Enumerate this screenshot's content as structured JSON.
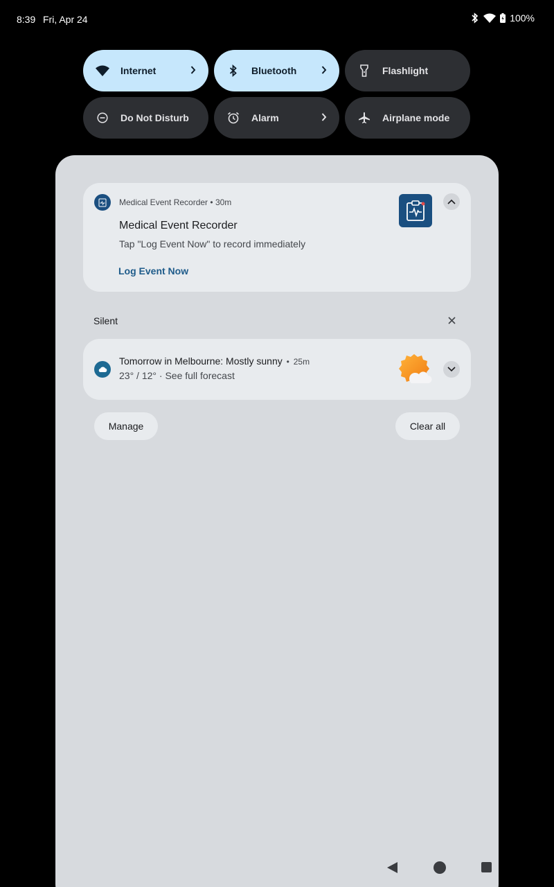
{
  "status_bar": {
    "time": "8:39",
    "date": "Fri, Apr 24",
    "battery": "100%",
    "icons": [
      "bluetooth-icon",
      "wifi-icon",
      "battery-icon"
    ]
  },
  "quick_settings": {
    "tiles": [
      {
        "label": "Internet",
        "icon": "wifi-icon",
        "active": true,
        "has_chevron": true
      },
      {
        "label": "Bluetooth",
        "icon": "bluetooth-icon",
        "active": true,
        "has_chevron": true
      },
      {
        "label": "Flashlight",
        "icon": "flashlight-icon",
        "active": false,
        "has_chevron": false
      },
      {
        "label": "Do Not Disturb",
        "icon": "do-not-disturb-icon",
        "active": false,
        "has_chevron": false
      },
      {
        "label": "Alarm",
        "icon": "alarm-icon",
        "active": false,
        "has_chevron": true
      },
      {
        "label": "Airplane mode",
        "icon": "airplane-icon",
        "active": false,
        "has_chevron": false
      }
    ]
  },
  "notifications": {
    "medical": {
      "app_name": "Medical Event Recorder",
      "separator": "•",
      "time": "30m",
      "title": "Medical Event Recorder",
      "text": "Tap \"Log Event Now\" to record immediately",
      "action": "Log Event Now"
    },
    "silent_section": {
      "label": "Silent"
    },
    "weather": {
      "title": "Tomorrow in Melbourne: Mostly sunny",
      "separator": "•",
      "time": "25m",
      "subtitle": "23° / 12° · See full forecast"
    }
  },
  "footer": {
    "manage": "Manage",
    "clear_all": "Clear all"
  },
  "colors": {
    "active_tile": "#c6e7fc",
    "inactive_tile": "#2d2f33",
    "shade": "#d7dade",
    "card": "#e8ebee",
    "accent": "#1e5b8a"
  }
}
